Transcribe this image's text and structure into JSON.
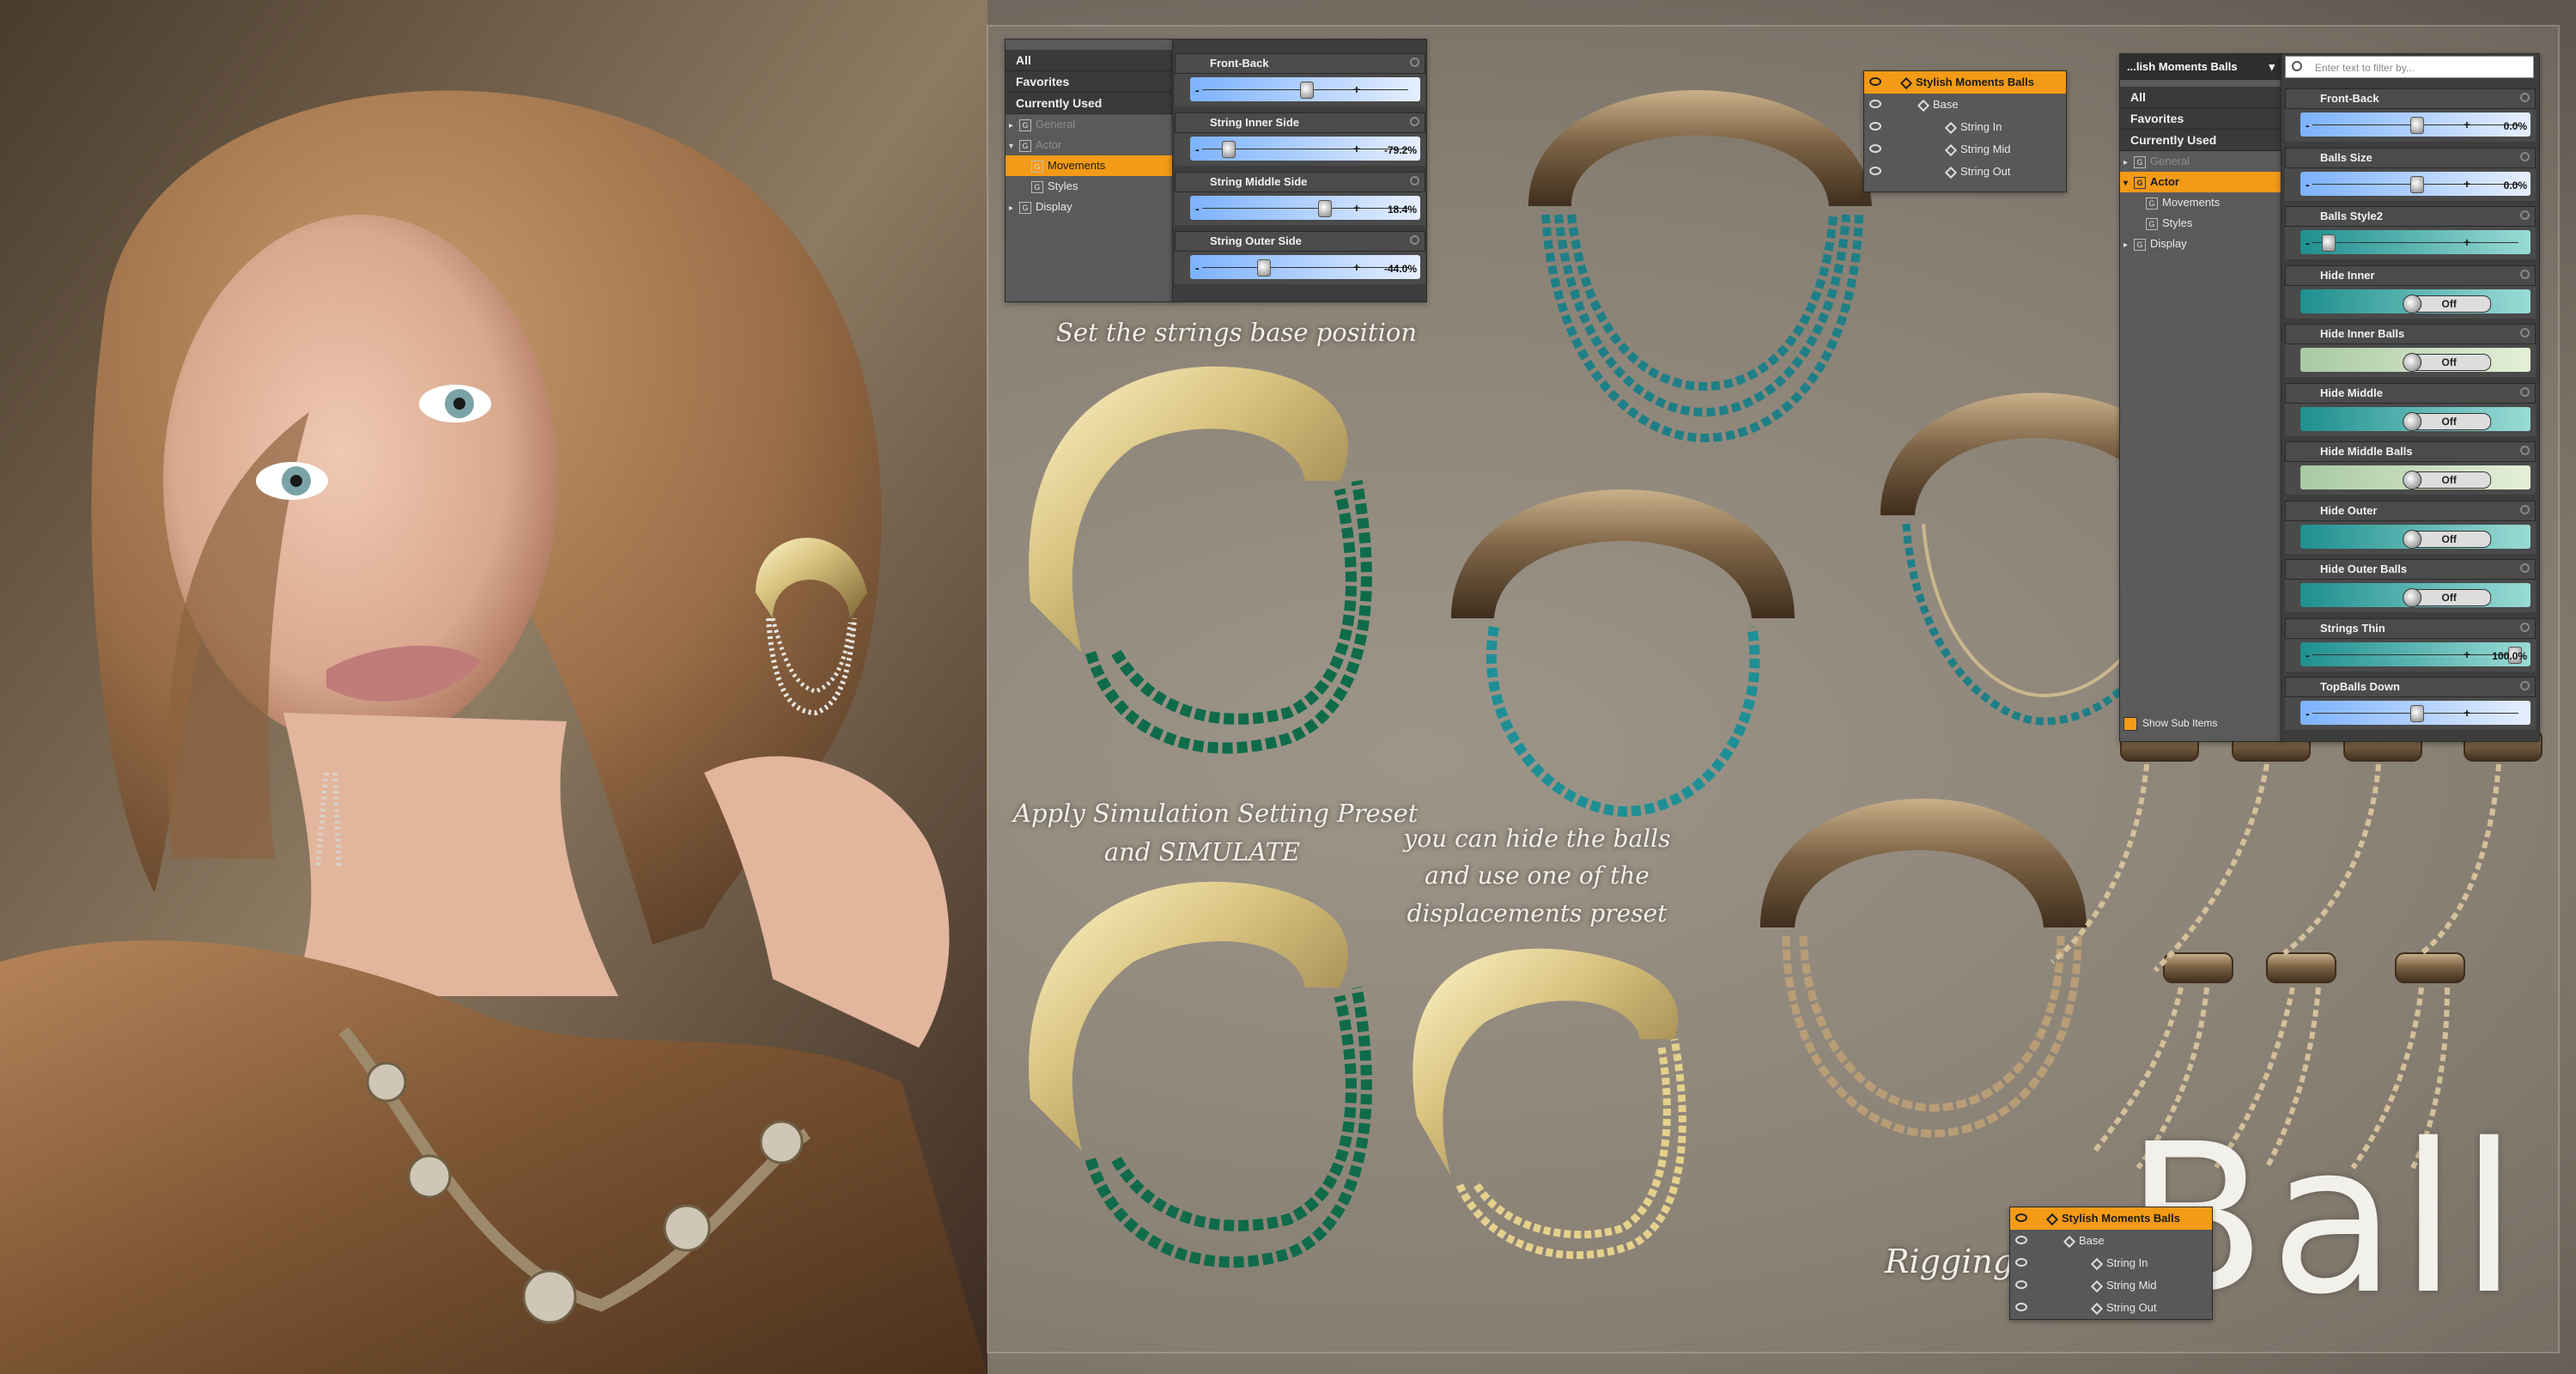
{
  "panel_left": {
    "categories": [
      "All",
      "Favorites",
      "Currently Used"
    ],
    "tree": [
      {
        "label": "General",
        "dim": true,
        "expanded": false
      },
      {
        "label": "Actor",
        "dim": true,
        "expanded": true
      },
      {
        "label": "Movements",
        "selected": true
      },
      {
        "label": "Styles"
      },
      {
        "label": "Display",
        "expanded": false
      }
    ],
    "sliders": [
      {
        "label": "Front-Back",
        "value": "",
        "fraction": 0.5
      },
      {
        "label": "String Inner Side",
        "value": "-79.2%",
        "fraction": 0.1
      },
      {
        "label": "String Middle Side",
        "value": "18.4%",
        "fraction": 0.59
      },
      {
        "label": "String Outer Side",
        "value": "-44.0%",
        "fraction": 0.28
      }
    ]
  },
  "panel_right": {
    "header": "...lish Moments Balls",
    "filter_placeholder": "Enter text to filter by...",
    "categories": [
      "All",
      "Favorites",
      "Currently Used"
    ],
    "tree": [
      {
        "label": "General",
        "dim": true
      },
      {
        "label": "Actor",
        "selected": true
      },
      {
        "label": "Movements"
      },
      {
        "label": "Styles"
      },
      {
        "label": "Display"
      }
    ],
    "show_sub_items": "Show Sub Items",
    "sliders": [
      {
        "label": "Front-Back",
        "kind": "slider",
        "value": "0.0%",
        "fraction": 0.5,
        "color": "blue"
      },
      {
        "label": "Balls Size",
        "kind": "slider",
        "value": "0.0%",
        "fraction": 0.5,
        "color": "blue"
      },
      {
        "label": "Balls Style2",
        "kind": "slider",
        "value": "",
        "fraction": 0.05,
        "color": "teal"
      },
      {
        "label": "Hide Inner",
        "kind": "toggle",
        "value": "Off",
        "color": "teal"
      },
      {
        "label": "Hide Inner Balls",
        "kind": "toggle",
        "value": "Off",
        "color": "green"
      },
      {
        "label": "Hide Middle",
        "kind": "toggle",
        "value": "Off",
        "color": "teal"
      },
      {
        "label": "Hide Middle Balls",
        "kind": "toggle",
        "value": "Off",
        "color": "green"
      },
      {
        "label": "Hide Outer",
        "kind": "toggle",
        "value": "Off",
        "color": "teal"
      },
      {
        "label": "Hide Outer Balls",
        "kind": "toggle",
        "value": "Off",
        "color": "teal"
      },
      {
        "label": "Strings Thin",
        "kind": "slider",
        "value": "100.0%",
        "fraction": 1.0,
        "color": "teal"
      },
      {
        "label": "TopBalls Down",
        "kind": "slider",
        "value": "",
        "fraction": 0.5,
        "color": "blue"
      }
    ]
  },
  "scene_tree_top": {
    "rows": [
      "Stylish Moments Balls",
      "Base",
      "String In",
      "String Mid",
      "String Out"
    ]
  },
  "scene_tree_bottom": {
    "rows": [
      "Stylish Moments Balls",
      "Base",
      "String In",
      "String Mid",
      "String Out"
    ]
  },
  "captions": {
    "base_position": "Set the strings base position",
    "simulate": "Apply Simulation Setting Preset\nand SIMULATE",
    "hide_balls": "you can hide the balls\nand use one of the\ndisplacements preset",
    "rigging": "Rigging"
  },
  "title": "Ball",
  "colors": {
    "accent_orange": "#f39a17",
    "panel_dark": "#3a3a3a",
    "bead_teal": "#1e7f86",
    "bead_green": "#0f6b4a",
    "gold": "#d9c27a",
    "bronze": "#8a6a48"
  }
}
